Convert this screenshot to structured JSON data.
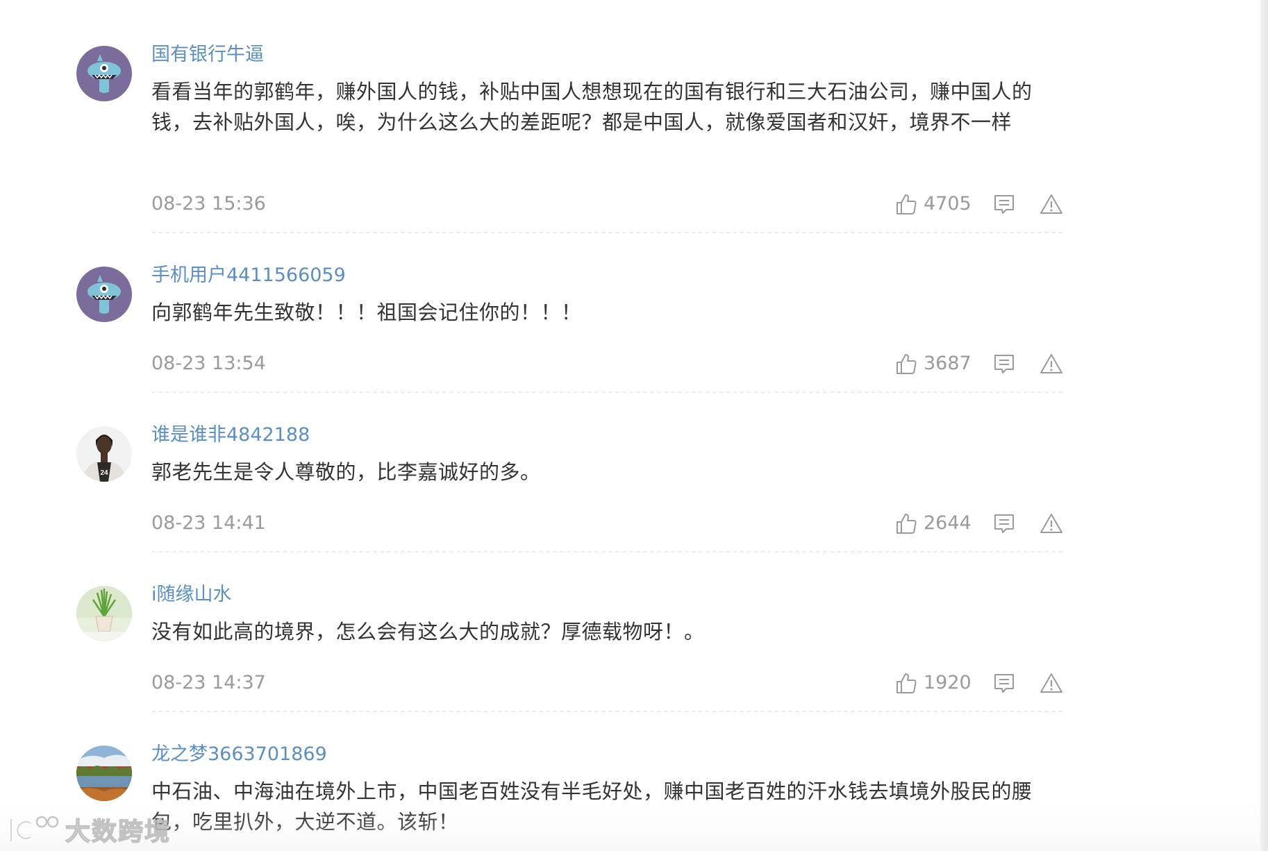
{
  "comments": [
    {
      "username": "国有银行牛逼",
      "avatar_icon": "monster-mascot-avatar",
      "text": "看看当年的郭鹤年，赚外国人的钱，补贴中国人想想现在的国有银行和三大石油公司，赚中国人的钱，去补贴外国人，唉，为什么这么大的差距呢？都是中国人，就像爱国者和汉奸，境界不一样",
      "time": "08-23 15:36",
      "likes": "4705"
    },
    {
      "username": "手机用户4411566059",
      "avatar_icon": "monster-mascot-avatar",
      "text": "向郭鹤年先生致敬！！！祖国会记住你的！！！",
      "time": "08-23 13:54",
      "likes": "3687"
    },
    {
      "username": "谁是谁非4842188",
      "avatar_icon": "person-photo-avatar",
      "text": "郭老先生是令人尊敬的，比李嘉诚好的多。",
      "time": "08-23 14:41",
      "likes": "2644"
    },
    {
      "username": "i随缘山水",
      "avatar_icon": "plant-photo-avatar",
      "text": "没有如此高的境界，怎么会有这么大的成就？厚德载物呀！。",
      "time": "08-23 14:37",
      "likes": "1920"
    },
    {
      "username": "龙之梦3663701869",
      "avatar_icon": "landscape-photo-avatar",
      "text": "中石油、中海油在境外上市，中国老百姓没有半毛好处，赚中国老百姓的汗水钱去填境外股民的腰包，吃里扒外，大逆不道。该斩！"
    }
  ],
  "icons": {
    "like": "thumbs-up-icon",
    "reply": "comment-icon",
    "report": "warning-icon"
  },
  "watermark": {
    "text": "大数跨境",
    "logo": "kjds-logo"
  },
  "colors": {
    "username": "#5b8fc4",
    "text": "#333333",
    "meta": "#9a9a9a",
    "divider": "#ececec"
  }
}
